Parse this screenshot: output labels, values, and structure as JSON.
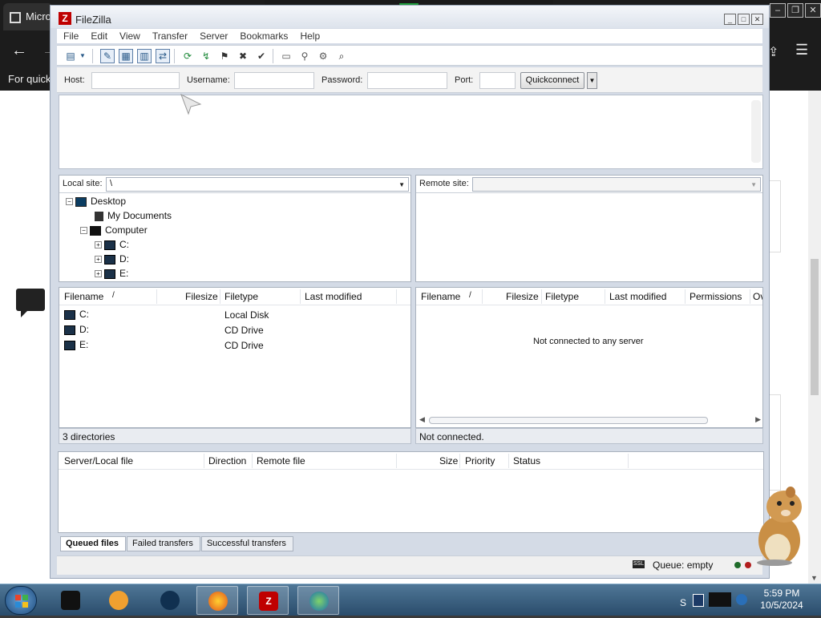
{
  "browser": {
    "tab_title": "Micro",
    "quick_text": "For quick"
  },
  "filezilla": {
    "title": "FileZilla",
    "menu": [
      "File",
      "Edit",
      "View",
      "Transfer",
      "Server",
      "Bookmarks",
      "Help"
    ],
    "quickconnect": {
      "host_label": "Host:",
      "username_label": "Username:",
      "password_label": "Password:",
      "port_label": "Port:",
      "host_value": "",
      "username_value": "",
      "password_value": "",
      "port_value": "",
      "button": "Quickconnect"
    },
    "local": {
      "site_label": "Local site:",
      "path": "\\",
      "tree": {
        "desktop": "Desktop",
        "my_documents": "My Documents",
        "computer": "Computer",
        "c": "C:",
        "d": "D:",
        "e": "E:"
      },
      "columns": {
        "filename": "Filename",
        "sort": "/",
        "filesize": "Filesize",
        "filetype": "Filetype",
        "last_modified": "Last modified"
      },
      "files": [
        {
          "name": "C:",
          "type": "Local Disk"
        },
        {
          "name": "D:",
          "type": "CD Drive"
        },
        {
          "name": "E:",
          "type": "CD Drive"
        }
      ],
      "status": "3 directories"
    },
    "remote": {
      "site_label": "Remote site:",
      "columns": {
        "filename": "Filename",
        "sort": "/",
        "filesize": "Filesize",
        "filetype": "Filetype",
        "last_modified": "Last modified",
        "permissions": "Permissions",
        "owner": "Ov"
      },
      "empty_message": "Not connected to any server",
      "status": "Not connected."
    },
    "queue": {
      "columns": {
        "server_local": "Server/Local file",
        "direction": "Direction",
        "remote_file": "Remote file",
        "size": "Size",
        "priority": "Priority",
        "status": "Status"
      },
      "tabs": [
        "Queued files",
        "Failed transfers",
        "Successful transfers"
      ]
    },
    "statusbar": {
      "queue": "Queue: empty"
    }
  },
  "taskbar": {
    "time": "5:59 PM",
    "date": "10/5/2024",
    "tray_fragment": "S"
  }
}
